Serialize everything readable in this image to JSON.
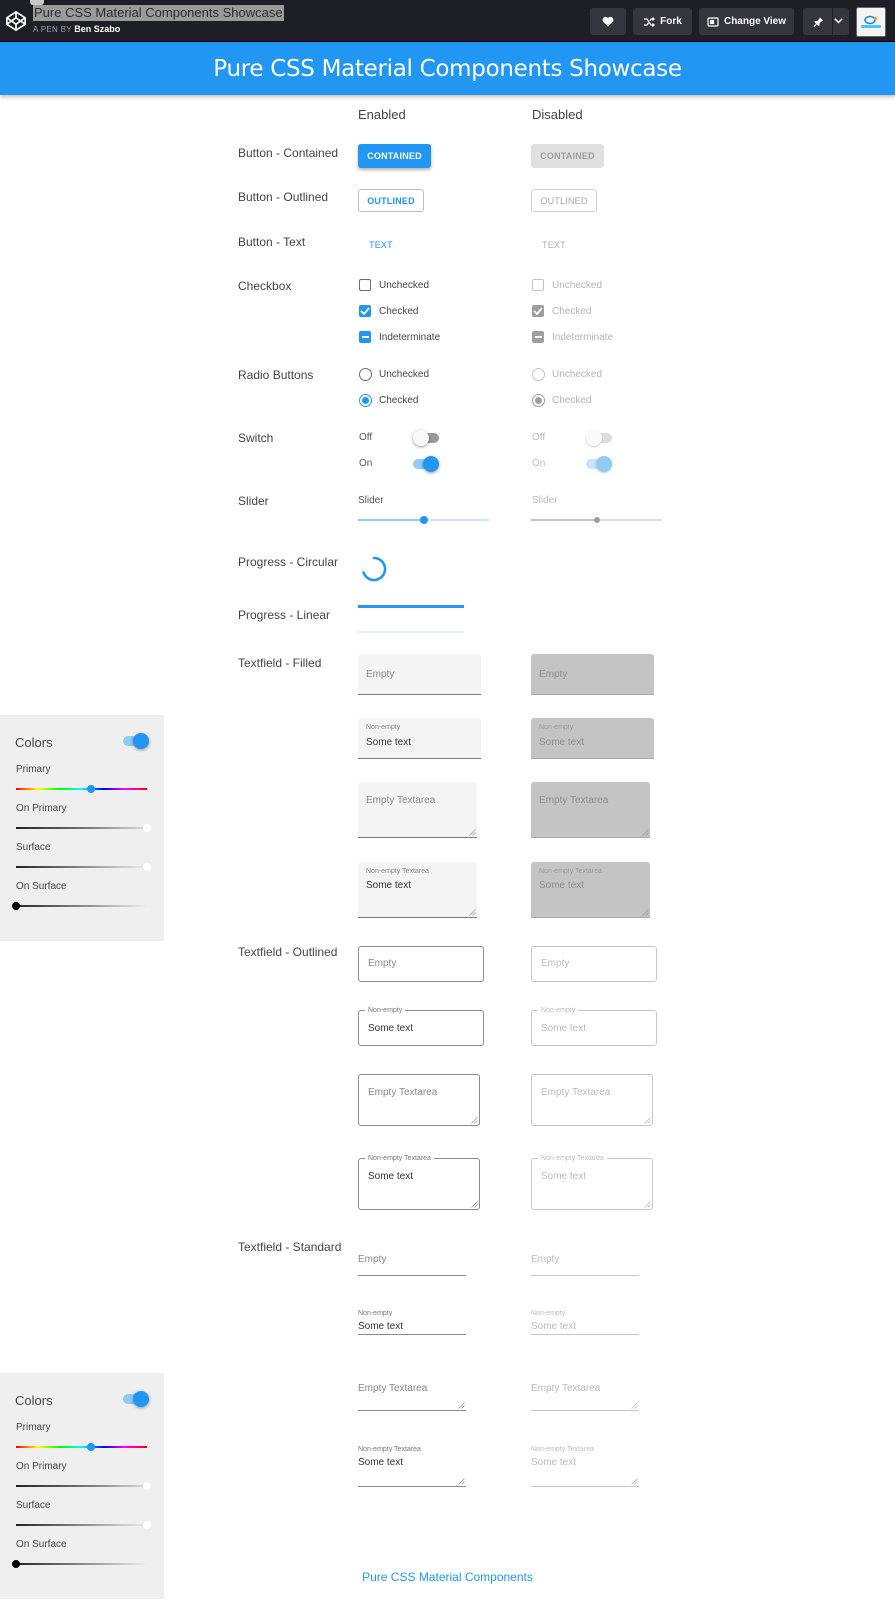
{
  "codepen": {
    "pen_title": "Pure CSS Material Components Showcase",
    "by_prefix": "A PEN BY",
    "author": "Ben Szabo",
    "fork_label": "Fork",
    "change_view_label": "Change View",
    "icons": [
      "codepen-logo-icon",
      "heart-icon",
      "fork-icon",
      "change-view-icon",
      "pin-icon",
      "chevron-down-icon"
    ]
  },
  "app_bar": {
    "title": "Pure CSS Material Components Showcase"
  },
  "columns": {
    "enabled": "Enabled",
    "disabled": "Disabled"
  },
  "rows": {
    "button_contained": "Button - Contained",
    "button_outlined": "Button - Outlined",
    "button_text": "Button - Text",
    "checkbox": "Checkbox",
    "radio": "Radio Buttons",
    "switch": "Switch",
    "slider": "Slider",
    "progress_circular": "Progress - Circular",
    "progress_linear": "Progress - Linear",
    "textfield_filled": "Textfield - Filled",
    "textfield_outlined": "Textfield - Outlined",
    "textfield_standard": "Textfield - Standard"
  },
  "buttons": {
    "contained": "CONTAINED",
    "outlined": "OUTLINED",
    "text": "TEXT"
  },
  "checkbox": {
    "unchecked": "Unchecked",
    "checked": "Checked",
    "indeterminate": "Indeterminate"
  },
  "radio": {
    "unchecked": "Unchecked",
    "checked": "Checked"
  },
  "switch": {
    "off": "Off",
    "on": "On"
  },
  "slider": {
    "label": "Slider",
    "enabled_value": 0.5,
    "disabled_value": 0.5
  },
  "progress": {
    "circular": "indeterminate",
    "linear": "indeterminate"
  },
  "textfield": {
    "empty": "Empty",
    "nonempty_label": "Non-empty",
    "value": "Some text",
    "empty_textarea": "Empty Textarea",
    "nonempty_textarea_label": "Non-empty Textarea"
  },
  "colors_panel": {
    "title": "Colors",
    "enabled": true,
    "primary": "Primary",
    "on_primary": "On Primary",
    "surface": "Surface",
    "on_surface": "On Surface",
    "primary_hue": 0.57,
    "on_primary_value": 1.0,
    "surface_value": 1.0,
    "on_surface_value": 0.0
  },
  "footer": {
    "link": "Pure CSS Material Components"
  },
  "colors": {
    "primary": "#2196f3",
    "topbar": "#1e1f26",
    "panel": "#efefef"
  }
}
